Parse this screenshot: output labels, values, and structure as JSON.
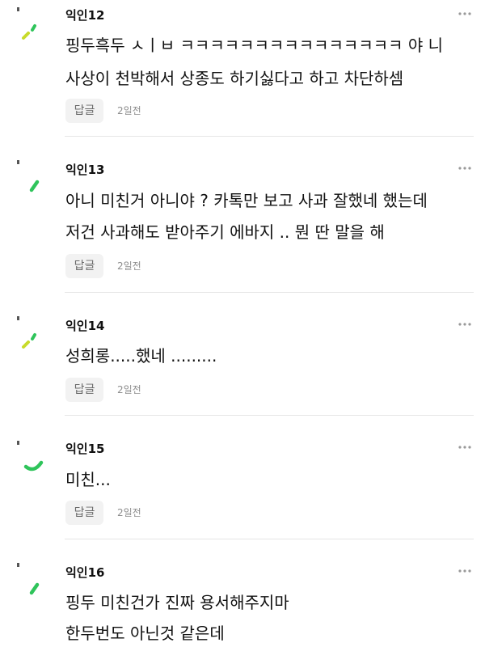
{
  "colors": {
    "accent_green": "#2fc45b",
    "accent_lime": "#c8db2a",
    "text_primary": "#111111",
    "text_secondary": "#8d8d8d",
    "button_bg": "#f2f2f2"
  },
  "comments": [
    {
      "author": "익인12",
      "lines": [
        "핑두흑두 ㅅㅣㅂ ㅋㅋㅋㅋㅋㅋㅋㅋㅋㅋㅋㅋㅋㅋㅋ 야 니",
        "사상이 천박해서 상종도 하기싫다고 하고 차단하셈"
      ],
      "reply_label": "답글",
      "time": "2일전"
    },
    {
      "author": "익인13",
      "lines": [
        "아니 미친거 아니야 ? 카톡만 보고 사과 잘했네 했는데",
        "저건 사과해도 받아주기 에바지 .. 뭔 딴 말을 해"
      ],
      "reply_label": "답글",
      "time": "2일전"
    },
    {
      "author": "익인14",
      "lines": [
        "성희롱.....했네 ........."
      ],
      "reply_label": "답글",
      "time": "2일전"
    },
    {
      "author": "익인15",
      "lines": [
        "미친..."
      ],
      "reply_label": "답글",
      "time": "2일전"
    },
    {
      "author": "익인16",
      "lines": [
        "핑두 미친건가 진짜 용서해주지마",
        "한두번도 아닌것 같은데"
      ]
    }
  ]
}
